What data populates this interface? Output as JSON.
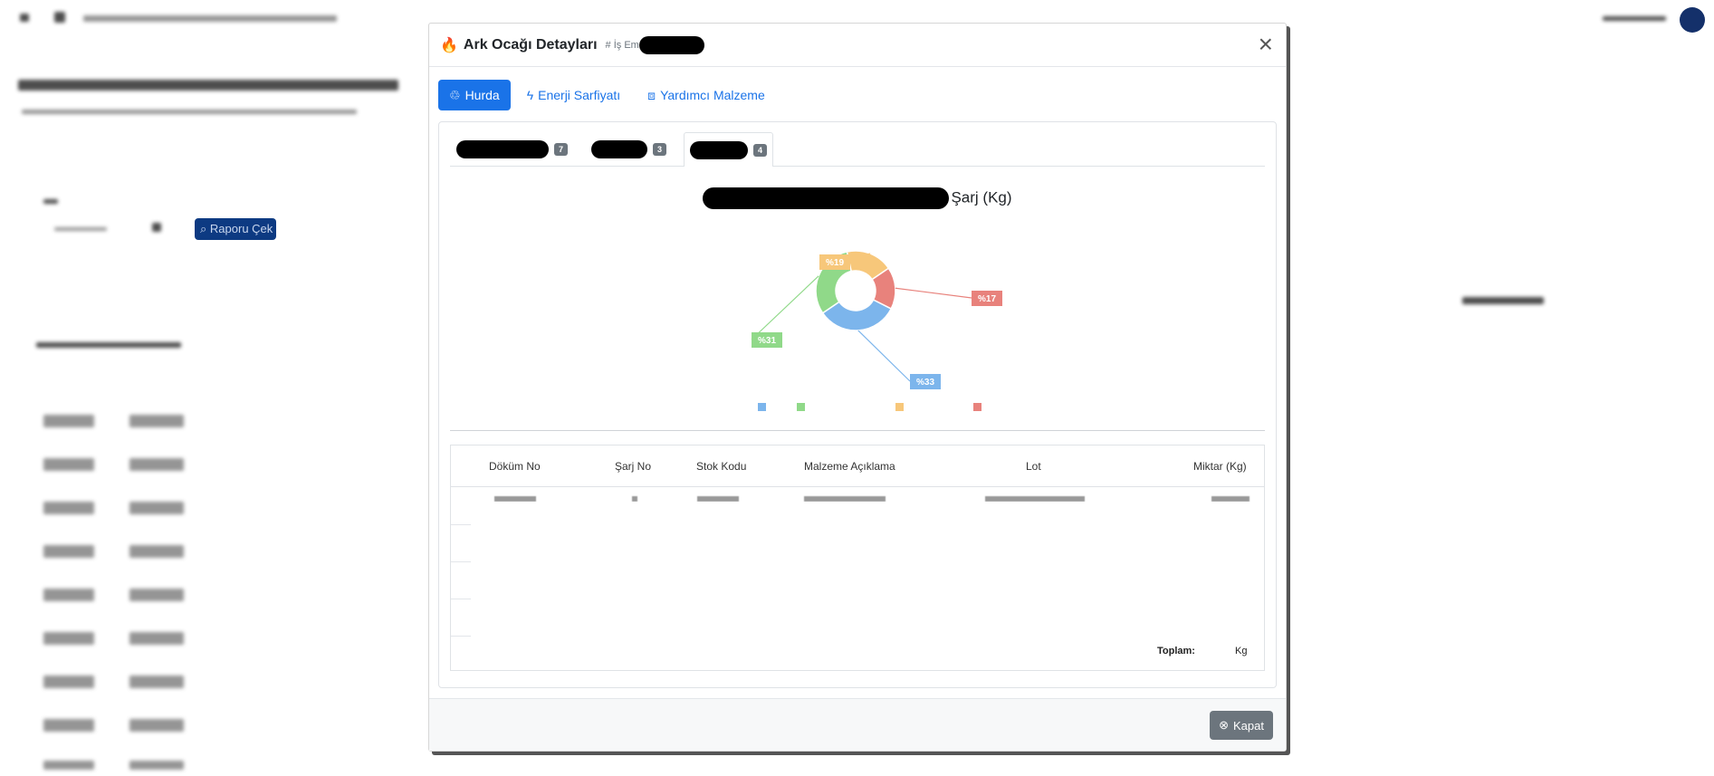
{
  "modal": {
    "title": "Ark Ocağı Detayları",
    "subtitle_prefix": "# İş Em",
    "close_label": "×"
  },
  "pills": [
    {
      "label": "Hurda",
      "active": true
    },
    {
      "label": "Enerji Sarfiyatı",
      "active": false
    },
    {
      "label": "Yardımcı Malzeme",
      "active": false
    }
  ],
  "tabs": [
    {
      "badge": "7",
      "active": false
    },
    {
      "badge": "3",
      "active": false
    },
    {
      "badge": "4",
      "active": true
    }
  ],
  "chart_title_suffix": "Şarj (Kg)",
  "chart_data": {
    "type": "pie",
    "donut": true,
    "slices": [
      {
        "label": "%33",
        "value": 33,
        "color": "#7cb5ec"
      },
      {
        "label": "%31",
        "value": 31,
        "color": "#90d989"
      },
      {
        "label": "%19",
        "value": 19,
        "color": "#f7c77a"
      },
      {
        "label": "%17",
        "value": 17,
        "color": "#e8827c"
      }
    ]
  },
  "table": {
    "columns": [
      "Döküm No",
      "Şarj No",
      "Stok Kodu",
      "Malzeme Açıklama",
      "Lot",
      "Miktar (Kg)"
    ],
    "footer_label": "Toplam:",
    "footer_unit": "Kg"
  },
  "footer": {
    "close_button": "Kapat"
  },
  "background": {
    "button_label": "Raporu Çek"
  }
}
